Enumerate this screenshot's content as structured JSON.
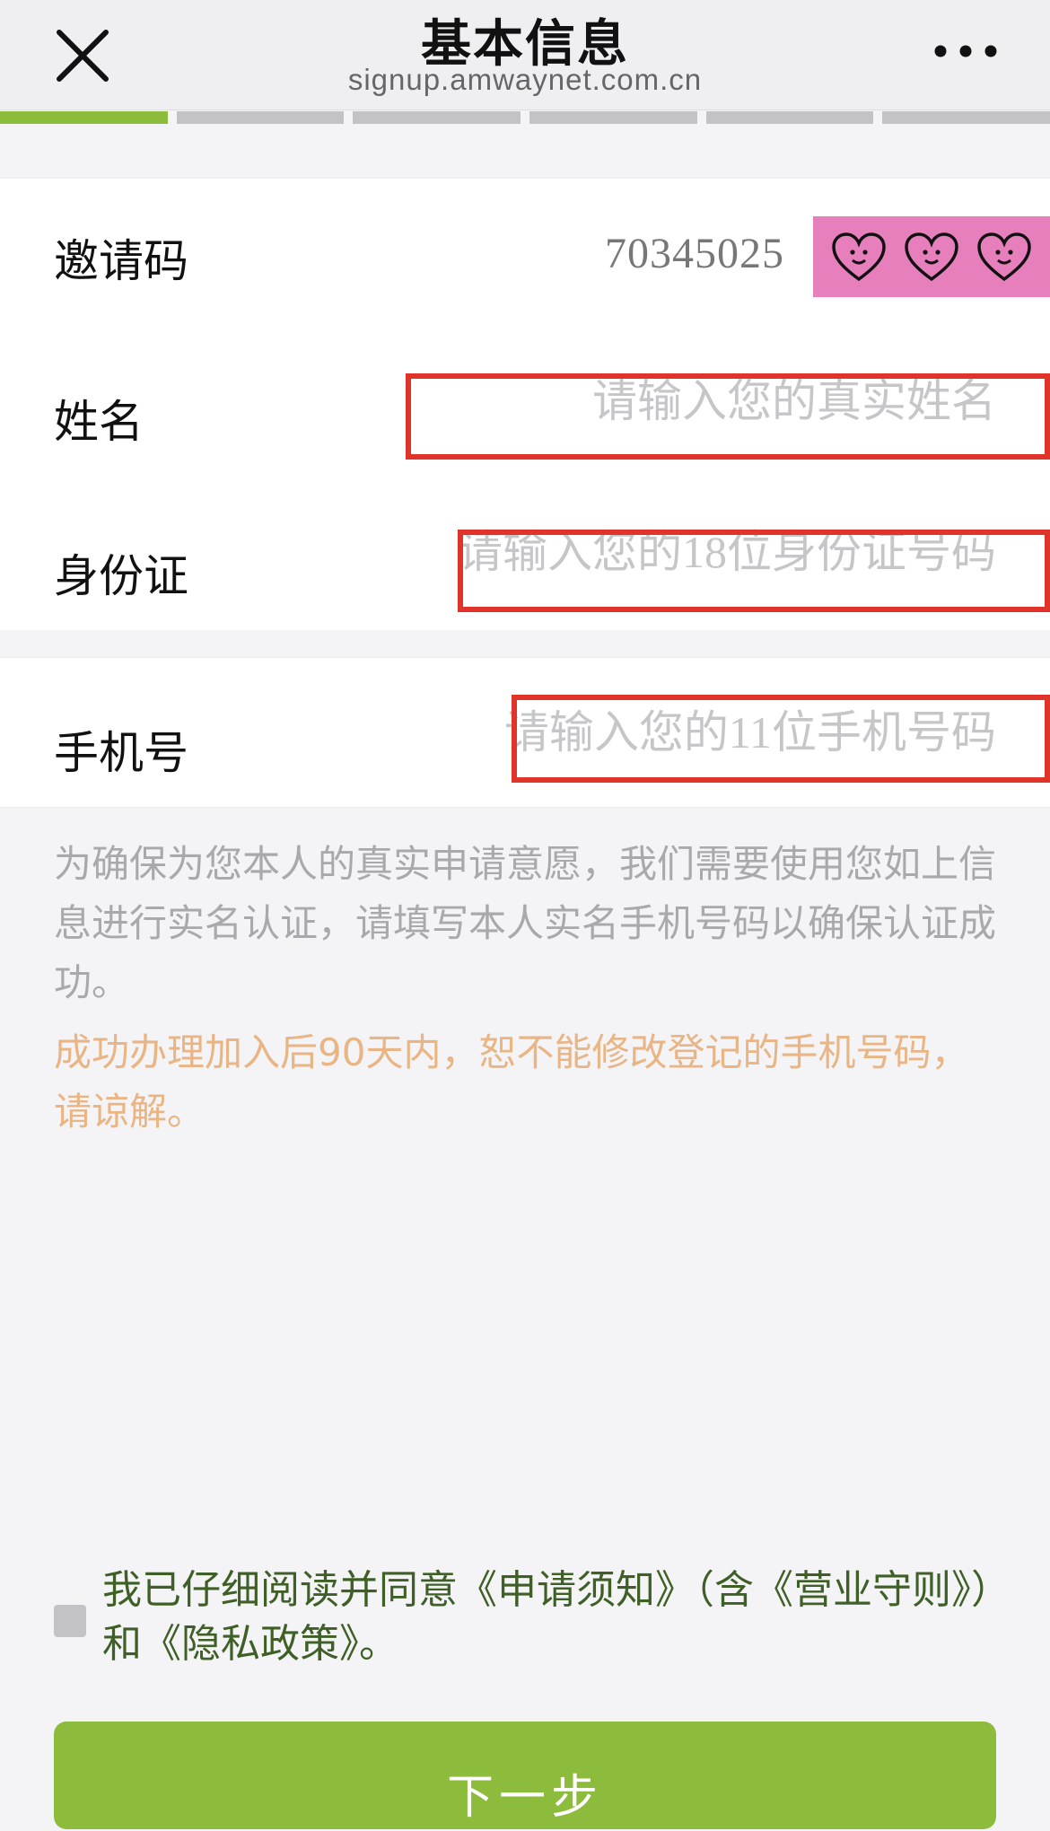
{
  "header": {
    "title": "基本信息",
    "subtitle": "signup.amwaynet.com.cn",
    "close_icon": "close-icon",
    "more_icon": "more-horizontal-icon"
  },
  "progress": {
    "total_steps": 6,
    "current_step": 1,
    "active_color": "#8dbb3c",
    "inactive_color": "#c3c3c7"
  },
  "form": {
    "invite": {
      "label": "邀请码",
      "value": "70345025",
      "badge_icon": "heart-face-icon"
    },
    "name": {
      "label": "姓名",
      "placeholder": "请输入您的真实姓名"
    },
    "id_card": {
      "label": "身份证",
      "placeholder": "请输入您的18位身份证号码"
    },
    "phone": {
      "label": "手机号",
      "placeholder": "请输入您的11位手机号码"
    }
  },
  "notes": {
    "info": "为确保为您本人的真实申请意愿，我们需要使用您如上信息进行实名认证，请填写本人实名手机号码以确保认证成功。",
    "warning": "成功办理加入后90天内，恕不能修改登记的手机号码，请谅解。"
  },
  "agreement": {
    "prefix": "我已仔细阅读并同意",
    "notice_link": "《申请须知》",
    "middle_open": "（含",
    "rules_link": "《营业守则》",
    "middle_close": "）和",
    "privacy_link": "《隐私政策》",
    "suffix": "。",
    "checked": false
  },
  "actions": {
    "next_label": "下一步"
  },
  "colors": {
    "accent": "#8dbb3c",
    "highlight_red": "#e0332a",
    "warning_text": "#e9b585",
    "badge_pink": "#e77fbd"
  }
}
